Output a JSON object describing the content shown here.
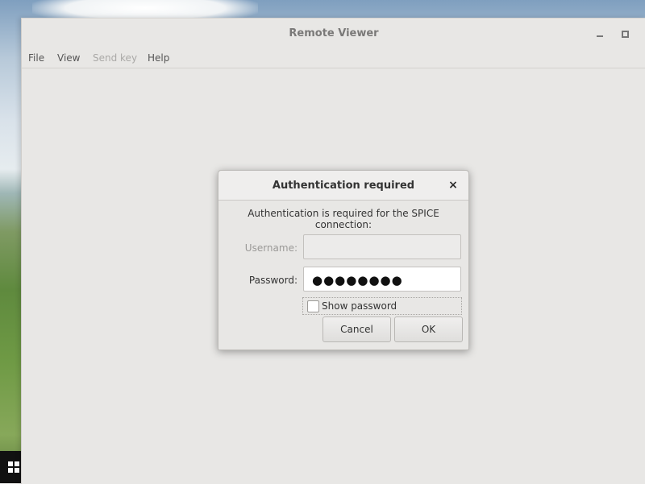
{
  "window": {
    "title": "Remote Viewer"
  },
  "menu": {
    "file": "File",
    "view": "View",
    "send_key": "Send key",
    "help": "Help"
  },
  "dialog": {
    "title": "Authentication required",
    "close_glyph": "×",
    "message": "Authentication is required for the SPICE connection:",
    "username_label": "Username:",
    "username_value": "",
    "password_label": "Password:",
    "password_mask": "●●●●●●●●",
    "show_password_label": "Show password",
    "show_password_checked": false,
    "cancel_label": "Cancel",
    "ok_label": "OK"
  },
  "icons": {
    "minimize": "minimize-icon",
    "maximize": "maximize-icon",
    "close": "close-icon",
    "start": "windows-start-icon"
  }
}
